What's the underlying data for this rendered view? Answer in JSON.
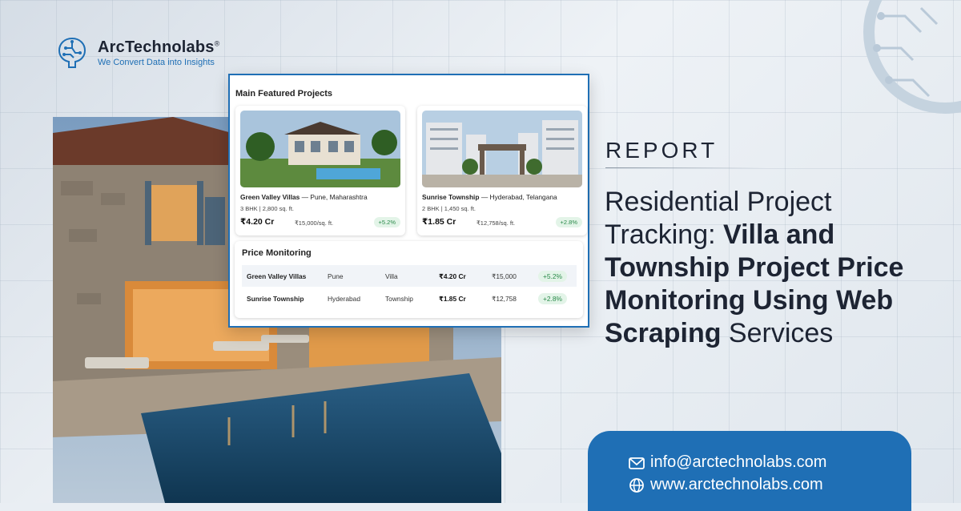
{
  "brand": {
    "name": "ArcTechnolabs",
    "trademark": "®",
    "tagline": "We Convert Data into Insights"
  },
  "panel": {
    "title": "Main Featured Projects",
    "projects": [
      {
        "name": "Green Valley Villas",
        "location": "— Pune, Maharashtra",
        "spec": "3 BHK | 2,800 sq. ft.",
        "price": "₹4.20 Cr",
        "rate": "₹15,000/sq. ft.",
        "change": "+5.2%",
        "image_icon": "villa-photo"
      },
      {
        "name": "Sunrise Township",
        "location": "— Hyderabad, Telangana",
        "spec": "2 BHK | 1,450 sq. ft.",
        "price": "₹1.85 Cr",
        "rate": "₹12,758/sq. ft.",
        "change": "+2.8%",
        "image_icon": "township-photo"
      }
    ],
    "price_monitoring": {
      "title": "Price Monitoring",
      "rows": [
        [
          "Green Valley Villas",
          "Pune",
          "Villa",
          "₹4.20 Cr",
          "₹15,000",
          "+5.2%"
        ],
        [
          "Sunrise Township",
          "Hyderabad",
          "Township",
          "₹1.85 Cr",
          "₹12,758",
          "+2.8%"
        ]
      ]
    }
  },
  "hero": {
    "kicker": "REPORT",
    "headline_parts": [
      {
        "text": "Residential Project Tracking: ",
        "bold": false
      },
      {
        "text": "Villa and Township Project Price Monitoring Using Web Scraping",
        "bold": true
      },
      {
        "text": " Services",
        "bold": false
      }
    ]
  },
  "contact": {
    "email": "info@arctechnolabs.com",
    "website": "www.arctechnolabs.com",
    "email_icon": "mail-icon",
    "website_icon": "globe-icon"
  },
  "colors": {
    "brand_blue": "#1f6fb5",
    "text_dark": "#1d2433",
    "positive_green": "#2a8a4a"
  }
}
